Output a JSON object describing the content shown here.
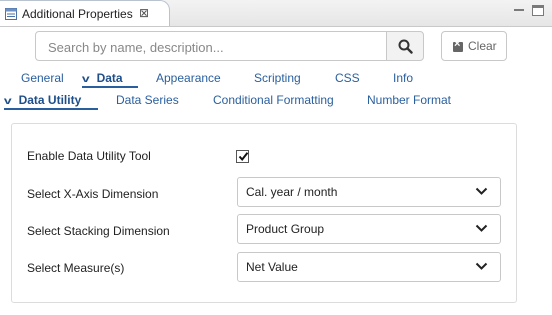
{
  "view": {
    "title": "Additional Properties",
    "close_glyph": "⊠"
  },
  "search": {
    "placeholder": "Search by name, description...",
    "value": "",
    "clear_label": "Clear"
  },
  "main_tabs": [
    {
      "label": "General",
      "active": false
    },
    {
      "label": "Data",
      "active": true
    },
    {
      "label": "Appearance",
      "active": false
    },
    {
      "label": "Scripting",
      "active": false
    },
    {
      "label": "CSS",
      "active": false
    },
    {
      "label": "Info",
      "active": false
    }
  ],
  "sub_tabs": [
    {
      "label": "Data Utility",
      "active": true
    },
    {
      "label": "Data Series",
      "active": false
    },
    {
      "label": "Conditional Formatting",
      "active": false
    },
    {
      "label": "Number Format",
      "active": false
    }
  ],
  "form": {
    "enable_label": "Enable Data Utility Tool",
    "enable_checked": true,
    "xaxis_label": "Select X-Axis Dimension",
    "xaxis_value": "Cal. year / month",
    "stacking_label": "Select Stacking Dimension",
    "stacking_value": "Product Group",
    "measure_label": "Select Measure(s)",
    "measure_value": "Net Value"
  },
  "colors": {
    "tab_text": "#2a5f9e",
    "tab_active": "#1e4f8a"
  },
  "icons": [
    "properties-icon",
    "close-icon",
    "minimize-icon",
    "maximize-icon",
    "search-icon",
    "clear-icon",
    "chevron-down-icon",
    "checkmark-icon"
  ]
}
